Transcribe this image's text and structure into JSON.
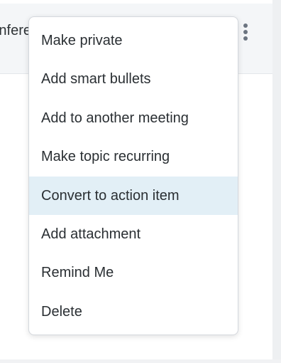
{
  "row": {
    "title_fragment": "nfere"
  },
  "menu": {
    "items": [
      {
        "label": "Make private"
      },
      {
        "label": "Add smart bullets"
      },
      {
        "label": "Add to another meeting"
      },
      {
        "label": "Make topic recurring"
      },
      {
        "label": "Convert to action item",
        "highlighted": true
      },
      {
        "label": "Add attachment"
      },
      {
        "label": "Remind Me"
      },
      {
        "label": "Delete"
      }
    ]
  },
  "colors": {
    "highlight": "#e2eff6",
    "text": "#2a2f33",
    "icon": "#6b7480"
  }
}
